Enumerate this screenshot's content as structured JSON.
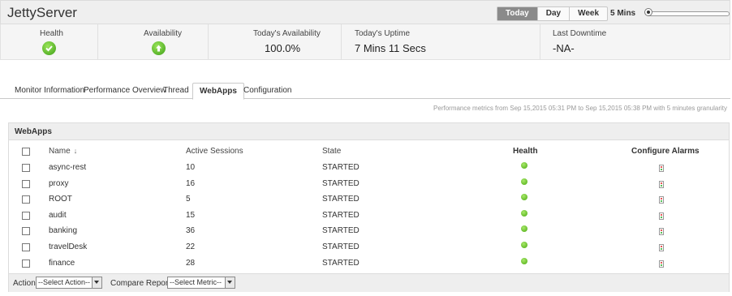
{
  "header": {
    "title": "JettyServer",
    "periods": [
      "Today",
      "Day",
      "Week"
    ],
    "active_period": "Today",
    "interval": "5 Mins"
  },
  "summary": {
    "health_label": "Health",
    "availability_label": "Availability",
    "todays_availability_label": "Today's Availability",
    "todays_availability_value": "100.0%",
    "todays_uptime_label": "Today's Uptime",
    "todays_uptime_value": "7 Mins 11 Secs",
    "last_downtime_label": "Last Downtime",
    "last_downtime_value": "-NA-"
  },
  "tabs": [
    "Monitor Information",
    "Performance Overview",
    "Thread",
    "WebApps",
    "Configuration"
  ],
  "active_tab": "WebApps",
  "perf_note": "Performance metrics from Sep 15,2015 05:31 PM to Sep 15,2015 05:38 PM with 5 minutes granularity",
  "panel": {
    "title": "WebApps",
    "columns": {
      "name": "Name",
      "sessions": "Active Sessions",
      "state": "State",
      "health": "Health",
      "alarms": "Configure Alarms"
    },
    "rows": [
      {
        "name": "async-rest",
        "sessions": "10",
        "state": "STARTED"
      },
      {
        "name": "proxy",
        "sessions": "16",
        "state": "STARTED"
      },
      {
        "name": "ROOT",
        "sessions": "5",
        "state": "STARTED"
      },
      {
        "name": "audit",
        "sessions": "15",
        "state": "STARTED"
      },
      {
        "name": "banking",
        "sessions": "36",
        "state": "STARTED"
      },
      {
        "name": "travelDesk",
        "sessions": "22",
        "state": "STARTED"
      },
      {
        "name": "finance",
        "sessions": "28",
        "state": "STARTED"
      }
    ]
  },
  "footer": {
    "action_label": "Action",
    "action_select": "--Select Action--",
    "compare_label": "Compare Reports",
    "compare_select": "--Select Metric--"
  },
  "colors": {
    "health_ok": "#3d9e16",
    "active_period_bg": "#8a8a8a"
  }
}
